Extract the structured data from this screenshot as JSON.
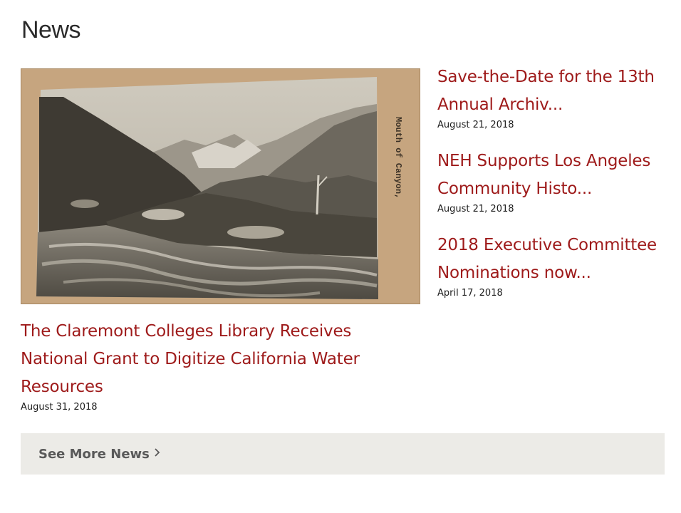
{
  "news": {
    "title": "News",
    "featured": {
      "headline": "The Claremont Colleges Library Receives National Grant to Digitize California Water Resources",
      "date": "August 31, 2018",
      "image_caption": "Mouth of Canyon,"
    },
    "items": [
      {
        "headline": "Save-the-Date for the 13th Annual Archiv...",
        "date": "August 21, 2018"
      },
      {
        "headline": "NEH Supports Los Angeles Community Histo...",
        "date": "August 21, 2018"
      },
      {
        "headline": "2018 Executive Committee Nominations now...",
        "date": "April 17, 2018"
      }
    ],
    "see_more_label": "See More News"
  },
  "colors": {
    "headline": "#9e1a1a",
    "bar_bg": "#ecebe7",
    "bar_text": "#595959"
  },
  "icons": {
    "see_more": "chevron-right-icon"
  }
}
